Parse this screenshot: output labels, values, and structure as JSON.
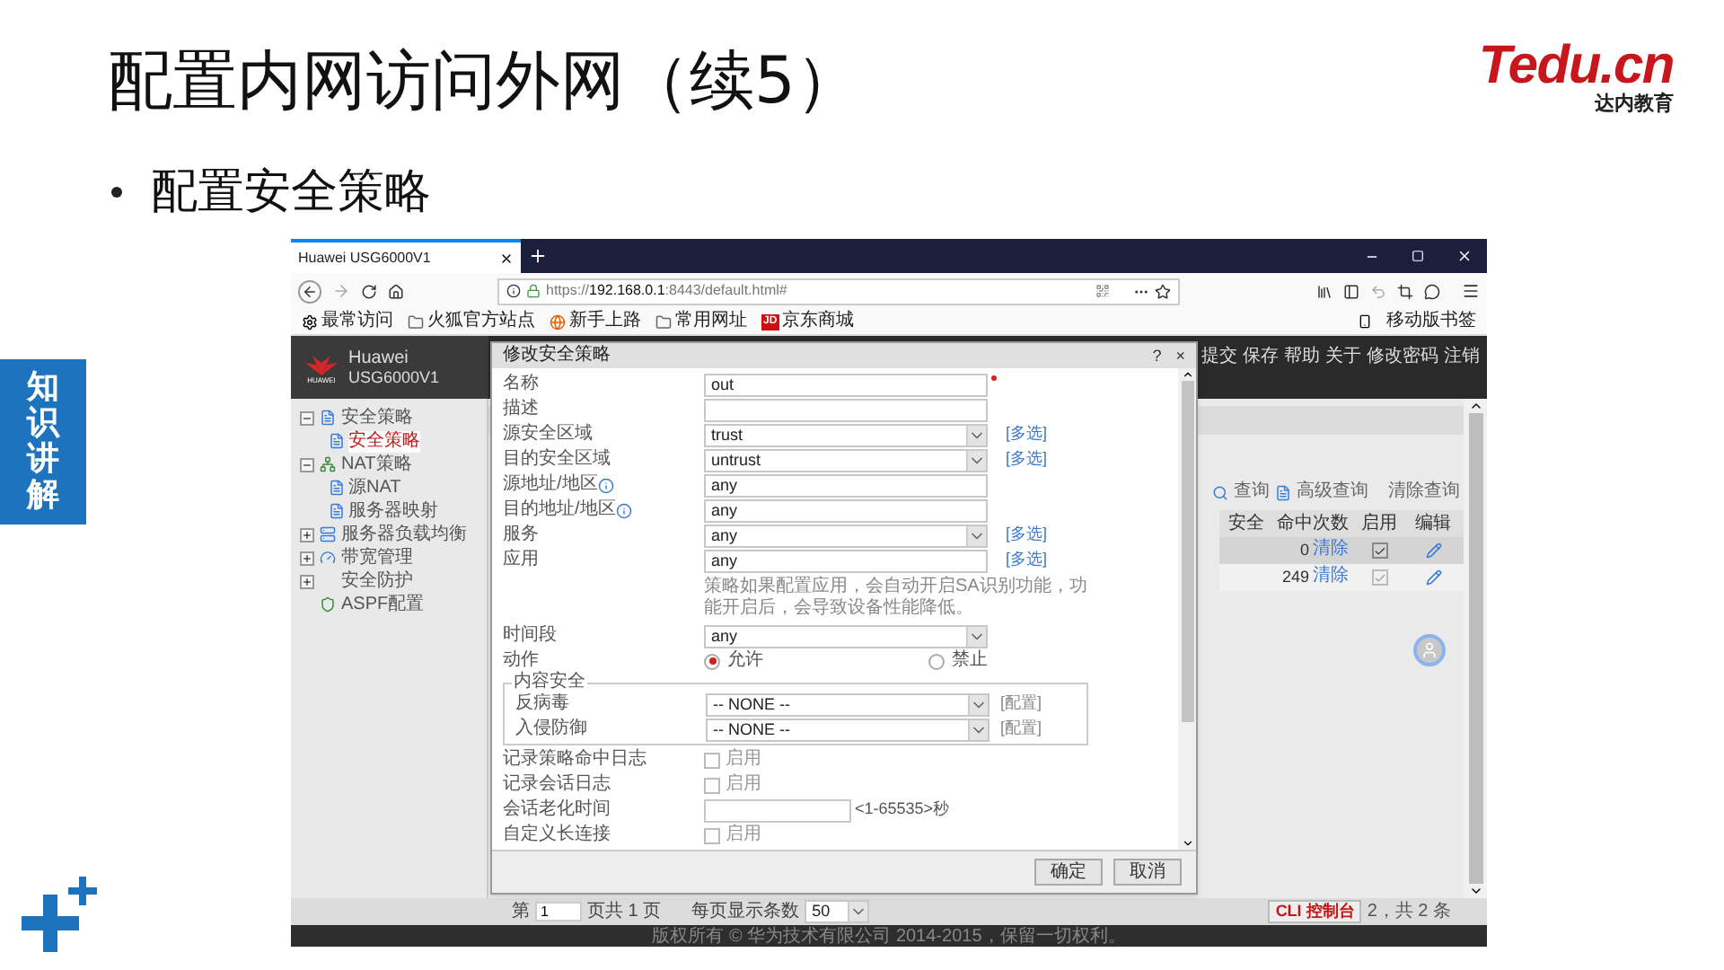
{
  "slide": {
    "title": "配置内网访问外网（续5）",
    "logo": "Tedu.cn",
    "tagline": "达内教育",
    "bullet": "配置安全策略",
    "side_label": "知识讲解"
  },
  "browser": {
    "tab_title": "Huawei USG6000V1",
    "url_scheme": "https://",
    "url_host": "192.168.0.1",
    "url_rest": ":8443/default.html#",
    "bookmarks": [
      {
        "kind": "gear",
        "label": "最常访问"
      },
      {
        "kind": "folder",
        "label": "火狐官方站点"
      },
      {
        "kind": "globe",
        "label": "新手上路"
      },
      {
        "kind": "folder",
        "label": "常用网址"
      },
      {
        "kind": "badge",
        "badge": "JD",
        "label": "京东商城"
      }
    ],
    "mobile_bookmarks": "移动版书签"
  },
  "app": {
    "logo_text": "HUAWEI",
    "brand": "Huawei",
    "model": "USG6000V1",
    "top_links": [
      "提交",
      "保存",
      "帮助",
      "关于",
      "修改密码",
      "注销"
    ],
    "nav": [
      {
        "label": "安全策略",
        "expanded": true,
        "children": [
          {
            "label": "安全策略",
            "selected": true
          }
        ]
      },
      {
        "label": "NAT策略",
        "expanded": true,
        "children": [
          {
            "label": "源NAT",
            "selected": false
          },
          {
            "label": "服务器映射",
            "selected": false
          }
        ]
      },
      {
        "label": "服务器负载均衡",
        "expanded": false
      },
      {
        "label": "带宽管理",
        "expanded": false
      },
      {
        "label": "安全防护",
        "expanded": false
      },
      {
        "label": "ASPF配置"
      }
    ],
    "toolbar": {
      "search": "查询",
      "advanced": "高级查询",
      "clear": "清除查询"
    },
    "table": {
      "columns": [
        "安全",
        "命中次数",
        "启用",
        "编辑"
      ],
      "rows": [
        {
          "hits": "0",
          "clear": "清除",
          "enabled": true,
          "disabled": false,
          "selected": true
        },
        {
          "hits": "249",
          "clear": "清除",
          "enabled": true,
          "disabled": true,
          "selected": false
        }
      ]
    },
    "pager": {
      "page_prefix": "第",
      "page": "1",
      "page_suffix": "页共 1 页",
      "per_page_label": "每页显示条数",
      "per_page": "50",
      "cli": "CLI 控制台",
      "count": "2，共 2 条"
    },
    "footer": "版权所有 © 华为技术有限公司 2014-2015，保留一切权利。"
  },
  "dialog": {
    "title": "修改安全策略",
    "title_buttons": [
      "?",
      "×"
    ],
    "fields": [
      {
        "kind": "text",
        "label": "名称",
        "value": "out",
        "required": true
      },
      {
        "kind": "text",
        "label": "描述"
      },
      {
        "kind": "select",
        "label": "源安全区域",
        "value": "trust",
        "link": "[多选]"
      },
      {
        "kind": "select",
        "label": "目的安全区域",
        "value": "untrust",
        "link": "[多选]"
      },
      {
        "kind": "text",
        "label": "源地址/地区",
        "value": "any",
        "help": true
      },
      {
        "kind": "text",
        "label": "目的地址/地区",
        "value": "any",
        "help": true
      },
      {
        "kind": "select",
        "label": "服务",
        "value": "any",
        "link": "[多选]"
      },
      {
        "kind": "text",
        "label": "应用",
        "value": "any",
        "link": "[多选]"
      },
      {
        "kind": "note",
        "text": "策略如果配置应用，会自动开启SA识别功能，功能开启后，会导致设备性能降低。"
      },
      {
        "kind": "select",
        "label": "时间段",
        "value": "any"
      },
      {
        "kind": "radio",
        "label": "动作",
        "options": [
          {
            "label": "允许",
            "selected": true
          },
          {
            "label": "禁止",
            "selected": false
          }
        ]
      },
      {
        "kind": "group",
        "legend": "内容安全",
        "items": [
          {
            "label": "反病毒",
            "value": "-- NONE --",
            "link": "[配置]"
          },
          {
            "label": "入侵防御",
            "value": "-- NONE --",
            "link": "[配置]"
          }
        ]
      },
      {
        "kind": "checkbox",
        "label": "记录策略命中日志",
        "text": "启用",
        "checked": false
      },
      {
        "kind": "checkbox",
        "label": "记录会话日志",
        "text": "启用",
        "checked": false
      },
      {
        "kind": "number",
        "label": "会话老化时间",
        "hint": "<1-65535>秒"
      },
      {
        "kind": "checkbox",
        "label": "自定义长连接",
        "text": "启用",
        "checked": false
      }
    ],
    "buttons": [
      "确定",
      "取消"
    ]
  }
}
